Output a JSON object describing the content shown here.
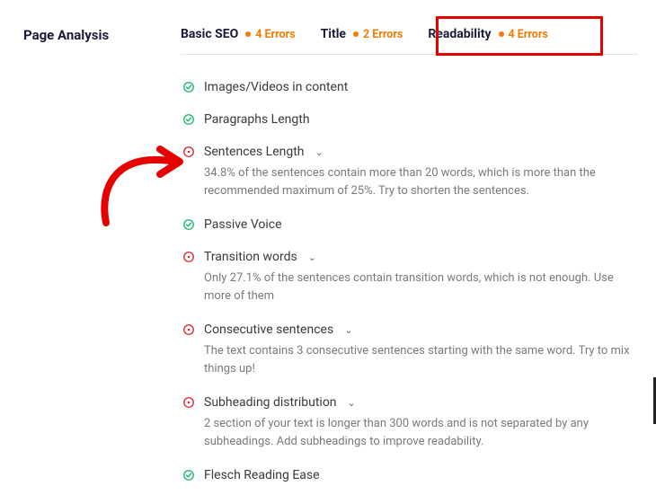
{
  "section_title": "Page Analysis",
  "tabs": [
    {
      "label": "Basic SEO",
      "errors": "4 Errors"
    },
    {
      "label": "Title",
      "errors": "2 Errors"
    },
    {
      "label": "Readability",
      "errors": "4 Errors"
    }
  ],
  "colors": {
    "error_badge": "#f57c00",
    "highlight": "#e60000",
    "ok": "#11b76b",
    "warn": "#e11d2b"
  },
  "items": [
    {
      "status": "ok",
      "title": "Images/Videos in content"
    },
    {
      "status": "ok",
      "title": "Paragraphs Length"
    },
    {
      "status": "warn",
      "title": "Sentences Length",
      "expandable": true,
      "desc": "34.8% of the sentences contain more than 20 words, which is more than the recommended maximum of 25%. Try to shorten the sentences."
    },
    {
      "status": "ok",
      "title": "Passive Voice"
    },
    {
      "status": "warn",
      "title": "Transition words",
      "expandable": true,
      "desc": "Only 27.1% of the sentences contain transition words, which is not enough. Use more of them"
    },
    {
      "status": "warn",
      "title": "Consecutive sentences",
      "expandable": true,
      "desc": "The text contains 3 consecutive sentences starting with the same word. Try to mix things up!"
    },
    {
      "status": "warn",
      "title": "Subheading distribution",
      "expandable": true,
      "desc": "2 section of your text is longer than 300 words and is not separated by any subheadings. Add subheadings to improve readability."
    },
    {
      "status": "ok",
      "title": "Flesch Reading Ease"
    }
  ]
}
